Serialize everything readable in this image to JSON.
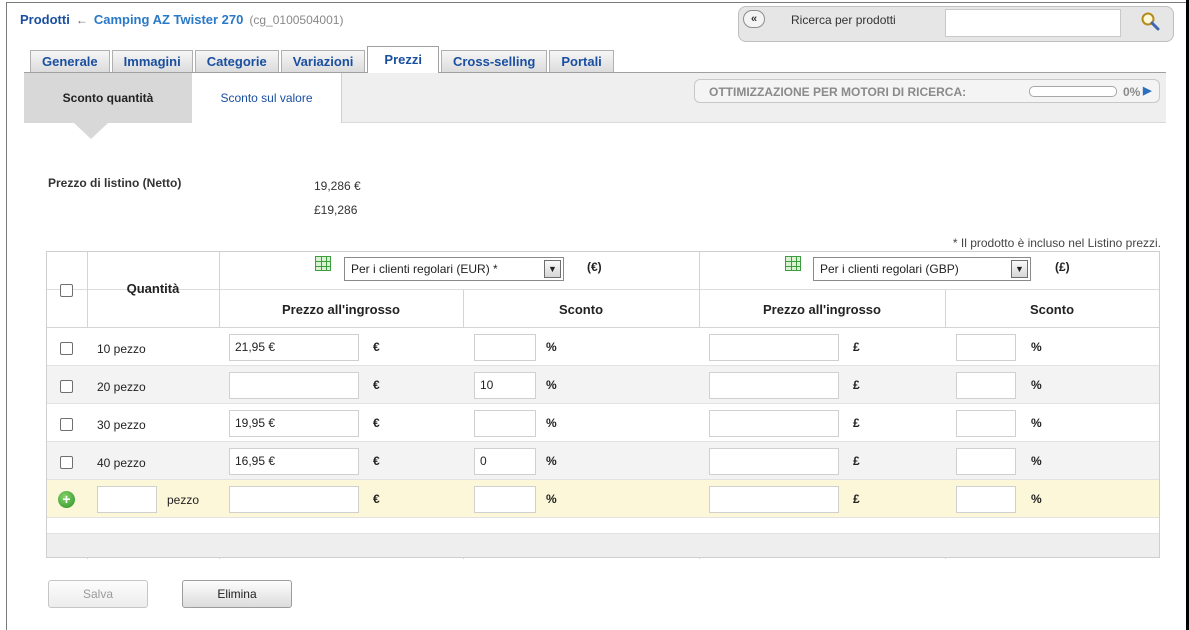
{
  "header": {
    "root": "Prodotti",
    "separator": "←",
    "title": "Camping AZ Twister 270",
    "code": "(cg_0100504001)"
  },
  "search": {
    "collapse_label": "«",
    "label": "Ricerca per prodotti",
    "value": "",
    "icon": "magnifier-icon"
  },
  "tabs": [
    "Generale",
    "Immagini",
    "Categorie",
    "Variazioni",
    "Prezzi",
    "Cross-selling",
    "Portali"
  ],
  "active_tab": "Prezzi",
  "subtabs": {
    "active": "Sconto quantità",
    "other": "Sconto sul valore"
  },
  "seo": {
    "label": "OTTIMIZZAZIONE PER MOTORI DI RICERCA:",
    "progress": 0,
    "percent_label": "0%",
    "arrow": "▶"
  },
  "list_price": {
    "label": "Prezzo di listino (Netto)",
    "eur": "19,286 €",
    "gbp": "£19,286"
  },
  "note": "* Il prodotto è incluso nel Listino prezzi.",
  "table": {
    "quantity_header": "Quantità",
    "eur_group": {
      "select": "Per i clienti regolari (EUR) *",
      "currency": "(€)",
      "symbol": "€"
    },
    "gbp_group": {
      "select": "Per i clienti regolari (GBP)",
      "currency": "(£)",
      "symbol": "£"
    },
    "col_wholesale": "Prezzo all'ingrosso",
    "col_discount": "Sconto",
    "percent": "%",
    "rows": [
      {
        "qty": "10 pezzo",
        "eur_price": "21,95 €",
        "eur_discount": "",
        "gbp_price": "",
        "gbp_discount": ""
      },
      {
        "qty": "20 pezzo",
        "eur_price": "",
        "eur_discount": "10",
        "gbp_price": "",
        "gbp_discount": ""
      },
      {
        "qty": "30 pezzo",
        "eur_price": "19,95 €",
        "eur_discount": "",
        "gbp_price": "",
        "gbp_discount": ""
      },
      {
        "qty": "40 pezzo",
        "eur_price": "16,95 €",
        "eur_discount": "0",
        "gbp_price": "",
        "gbp_discount": ""
      }
    ],
    "new_row": {
      "unit": "pezzo",
      "add_icon": "add-icon"
    }
  },
  "buttons": {
    "save": "Salva",
    "delete": "Elimina"
  },
  "colors": {
    "link_blue": "#1a4fa0",
    "new_row_bg": "#fcf7d9",
    "add_green": "#2b8f24"
  }
}
